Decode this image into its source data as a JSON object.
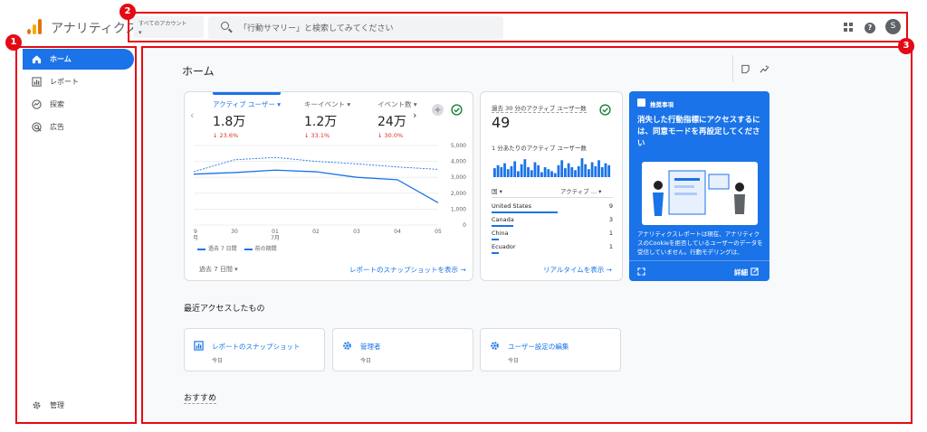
{
  "app": {
    "title": "アナリティクス"
  },
  "account": {
    "label": "すべてのアカウント",
    "caret": "▾"
  },
  "search": {
    "placeholder": "「行動サマリー」と検索してみてください"
  },
  "header": {
    "help": "?",
    "avatar_letter": "S"
  },
  "sidebar": {
    "items": [
      {
        "label": "ホーム",
        "icon": "home-icon",
        "active": true
      },
      {
        "label": "レポート",
        "icon": "bar-chart-icon",
        "active": false
      },
      {
        "label": "探索",
        "icon": "explore-icon",
        "active": false
      },
      {
        "label": "広告",
        "icon": "ads-icon",
        "active": false
      }
    ],
    "admin_label": "管理"
  },
  "main": {
    "title": "ホーム",
    "kpis": [
      {
        "label": "アクティブ ユーザー ▾",
        "value": "1.8万",
        "change": "↓ 23.6%"
      },
      {
        "label": "キーイベント ▾",
        "value": "1.2万",
        "change": "↓ 33.1%"
      },
      {
        "label": "イベント数 ▾",
        "value": "24万",
        "change": "↓ 30.0%"
      }
    ],
    "legend": {
      "current": "過去 7 日間",
      "previous": "前の期間"
    },
    "period": "過去 7 日間 ▾",
    "snapshot_link": "レポートのスナップショットを表示 →",
    "realtime": {
      "title": "過去 30 分のアクティブ ユーザー数",
      "value": "49",
      "subtitle": "1 分あたりのアクティブ ユーザー数",
      "col_country": "国 ▾",
      "col_users": "アクティブ ... ▾",
      "countries": [
        {
          "name": "United States",
          "count": "9",
          "share": 0.55
        },
        {
          "name": "Canada",
          "count": "3",
          "share": 0.18
        },
        {
          "name": "China",
          "count": "1",
          "share": 0.06
        },
        {
          "name": "Ecuador",
          "count": "1",
          "share": 0.06
        }
      ],
      "bars": [
        0.45,
        0.6,
        0.5,
        0.7,
        0.4,
        0.55,
        0.8,
        0.3,
        0.65,
        0.9,
        0.5,
        0.35,
        0.75,
        0.6,
        0.25,
        0.5,
        0.4,
        0.3,
        0.2,
        0.6,
        0.85,
        0.45,
        0.7,
        0.5,
        0.35,
        0.55,
        0.95,
        0.65,
        0.4,
        0.75,
        0.55,
        0.85,
        0.5,
        0.7,
        0.6
      ],
      "link": "リアルタイムを表示 →"
    },
    "promo": {
      "badge": "推奨事項",
      "headline": "消失した行動指標にアクセスするには、同意モードを再設定してください",
      "body": "アナリティクスレポートは現在、アナリティクスのCookieを拒否しているユーザーのデータを受信していません。行動モデリングは、",
      "detail": "詳細"
    },
    "recent_title": "最近アクセスしたもの",
    "recent": [
      {
        "label": "レポートのスナップショット",
        "date": "今日",
        "icon": "report-icon"
      },
      {
        "label": "管理者",
        "date": "今日",
        "icon": "settings-icon"
      },
      {
        "label": "ユーザー設定の編集",
        "date": "今日",
        "icon": "settings-icon"
      }
    ],
    "recommend_title": "おすすめ"
  },
  "chart_data": {
    "type": "line",
    "categories": [
      "29\n6月",
      "30",
      "01\n7月",
      "02",
      "03",
      "04",
      "05"
    ],
    "series": [
      {
        "name": "過去 7 日間",
        "values": [
          3200,
          3300,
          3450,
          3350,
          3000,
          2850,
          1400
        ],
        "style": "solid"
      },
      {
        "name": "前の期間",
        "values": [
          3350,
          4100,
          4250,
          4000,
          3850,
          3650,
          3500
        ],
        "style": "dashed"
      }
    ],
    "y_ticks": [
      "5,000",
      "4,000",
      "3,000",
      "2,000",
      "1,000",
      "0"
    ],
    "ylim": [
      0,
      5000
    ],
    "color": "#1a73e8"
  },
  "annotations": [
    "1",
    "2",
    "3"
  ]
}
